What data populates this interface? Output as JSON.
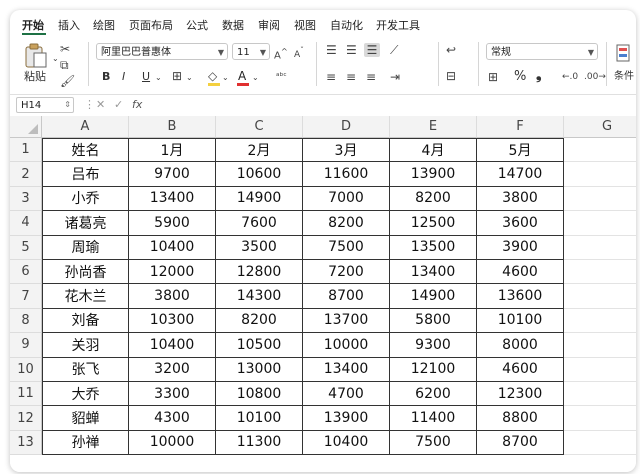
{
  "tabs": [
    "开始",
    "插入",
    "绘图",
    "页面布局",
    "公式",
    "数据",
    "审阅",
    "视图",
    "自动化",
    "开发工具"
  ],
  "ribbon": {
    "paste_label": "粘贴",
    "font_name": "阿里巴巴普惠体",
    "font_size": "11",
    "bold": "B",
    "italic": "I",
    "underline": "U",
    "number_format": "常规",
    "percent": "%",
    "comma": "❟",
    "cond_format_label": "条件"
  },
  "formula_bar": {
    "name_box": "H14",
    "fx": "fx",
    "formula": ""
  },
  "sheet": {
    "col_headers": [
      "A",
      "B",
      "C",
      "D",
      "E",
      "F",
      "G"
    ],
    "row_headers": [
      "1",
      "2",
      "3",
      "4",
      "5",
      "6",
      "7",
      "8",
      "9",
      "10",
      "11",
      "12",
      "13"
    ],
    "rows": [
      [
        "姓名",
        "1月",
        "2月",
        "3月",
        "4月",
        "5月"
      ],
      [
        "吕布",
        "9700",
        "10600",
        "11600",
        "13900",
        "14700"
      ],
      [
        "小乔",
        "13400",
        "14900",
        "7000",
        "8200",
        "3800"
      ],
      [
        "诸葛亮",
        "5900",
        "7600",
        "8200",
        "12500",
        "3600"
      ],
      [
        "周瑜",
        "10400",
        "3500",
        "7500",
        "13500",
        "3900"
      ],
      [
        "孙尚香",
        "12000",
        "12800",
        "7200",
        "13400",
        "4600"
      ],
      [
        "花木兰",
        "3800",
        "14300",
        "8700",
        "14900",
        "13600"
      ],
      [
        "刘备",
        "10300",
        "8200",
        "13700",
        "5800",
        "10100"
      ],
      [
        "关羽",
        "10400",
        "10500",
        "10000",
        "9300",
        "8000"
      ],
      [
        "张飞",
        "3200",
        "13000",
        "13400",
        "12100",
        "4600"
      ],
      [
        "大乔",
        "3300",
        "10800",
        "4700",
        "6200",
        "12300"
      ],
      [
        "貂蝉",
        "4300",
        "10100",
        "13900",
        "11400",
        "8800"
      ],
      [
        "孙禅",
        "10000",
        "11300",
        "10400",
        "7500",
        "8700"
      ]
    ]
  }
}
